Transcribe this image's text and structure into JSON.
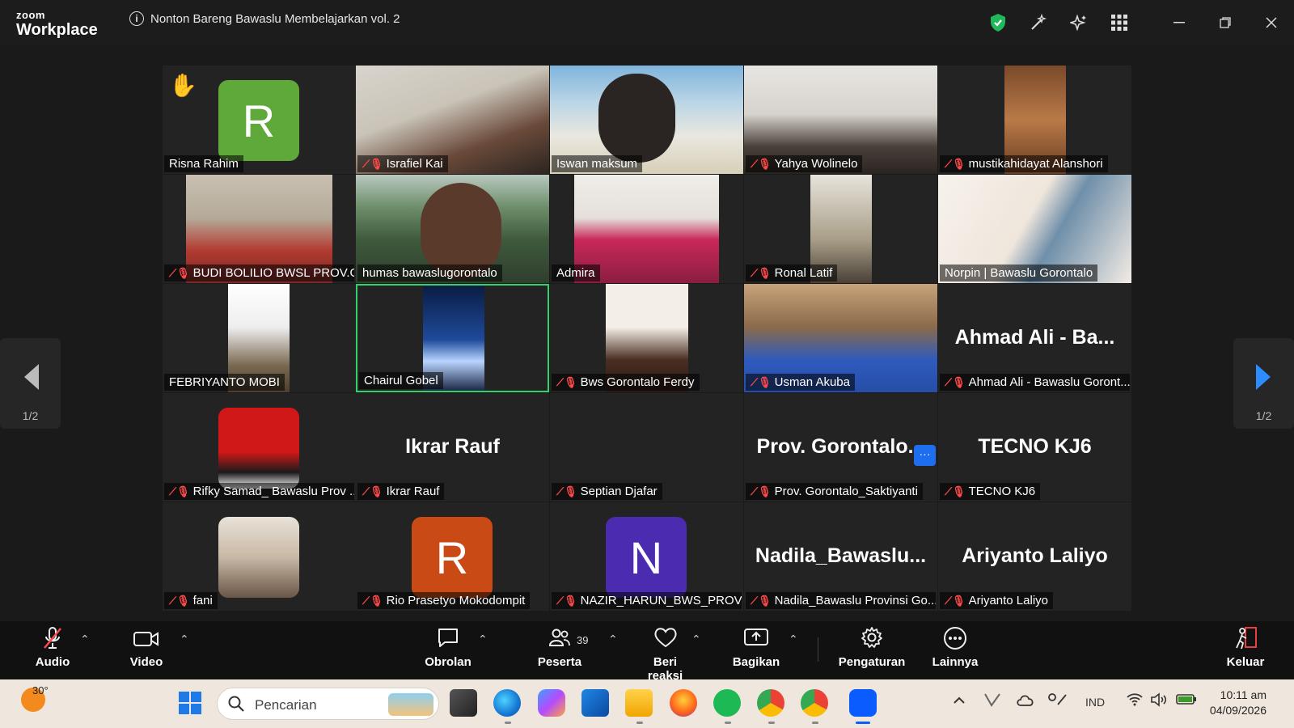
{
  "app": {
    "logo_top": "zoom",
    "logo_bottom": "Workplace",
    "meeting_title": "Nonton Bareng Bawaslu Membelajarkan vol. 2"
  },
  "colors": {
    "active_border": "#2fd26b",
    "mic_muted": "#ff4a4a",
    "shield": "#1fb85a",
    "avatar_green": "#5fa83a",
    "avatar_orange": "#c94a15",
    "avatar_purple": "#4b2bb0"
  },
  "participants": [
    {
      "name": "Risna Rahim",
      "muted": false,
      "avatar_letter": "R",
      "hand_raised": true
    },
    {
      "name": "Israfiel Kai",
      "muted": true
    },
    {
      "name": "Iswan maksum",
      "muted": false
    },
    {
      "name": "Yahya Wolinelo",
      "muted": true
    },
    {
      "name": "mustikahidayat Alanshori",
      "muted": true
    },
    {
      "name": "BUDI BOLILIO BWSL PROV.G...",
      "muted": true
    },
    {
      "name": "humas bawaslugorontalo",
      "muted": false
    },
    {
      "name": "Admira",
      "muted": false
    },
    {
      "name": "Ronal Latif",
      "muted": true
    },
    {
      "name": "Norpin | Bawaslu Gorontalo",
      "muted": false
    },
    {
      "name": "FEBRIYANTO MOBI",
      "muted": false
    },
    {
      "name": "Chairul Gobel",
      "muted": false,
      "active_speaker": true
    },
    {
      "name": "Bws Gorontalo Ferdy",
      "muted": true
    },
    {
      "name": "Usman Akuba",
      "muted": true
    },
    {
      "name": "Ahmad Ali - Bawaslu Goront...",
      "muted": true,
      "display_text": "Ahmad Ali - Ba..."
    },
    {
      "name": "Rifky Samad_ Bawaslu Prov ...",
      "muted": true
    },
    {
      "name": "Ikrar Rauf",
      "muted": true,
      "display_text": "Ikrar Rauf"
    },
    {
      "name": "Septian Djafar",
      "muted": true
    },
    {
      "name": "Prov. Gorontalo_Saktiyanti",
      "muted": true,
      "display_text": "Prov. Gorontalo..."
    },
    {
      "name": "TECNO KJ6",
      "muted": true,
      "display_text": "TECNO KJ6"
    },
    {
      "name": "fani",
      "muted": true
    },
    {
      "name": "Rio Prasetyo Mokodompit",
      "muted": true,
      "avatar_letter": "R"
    },
    {
      "name": "NAZIR_HARUN_BWS_PROV. ...",
      "muted": true,
      "avatar_letter": "N"
    },
    {
      "name": "Nadila_Bawaslu Provinsi Go...",
      "muted": true,
      "display_text": "Nadila_Bawaslu..."
    },
    {
      "name": "Ariyanto Laliyo",
      "muted": true,
      "display_text": "Ariyanto Laliyo"
    }
  ],
  "nav": {
    "page_left": "1/2",
    "page_right": "1/2"
  },
  "more_label": "···",
  "toolbar": {
    "audio": "Audio",
    "video": "Video",
    "chat": "Obrolan",
    "participants": "Peserta",
    "participants_count": "39",
    "reactions": "Beri reaksi",
    "share": "Bagikan",
    "settings": "Pengaturan",
    "more": "Lainnya",
    "leave": "Keluar"
  },
  "taskbar": {
    "temperature": "30°",
    "search_placeholder": "Pencarian",
    "language": "IND",
    "time": "10:11 am",
    "date": "04/09/2026"
  }
}
